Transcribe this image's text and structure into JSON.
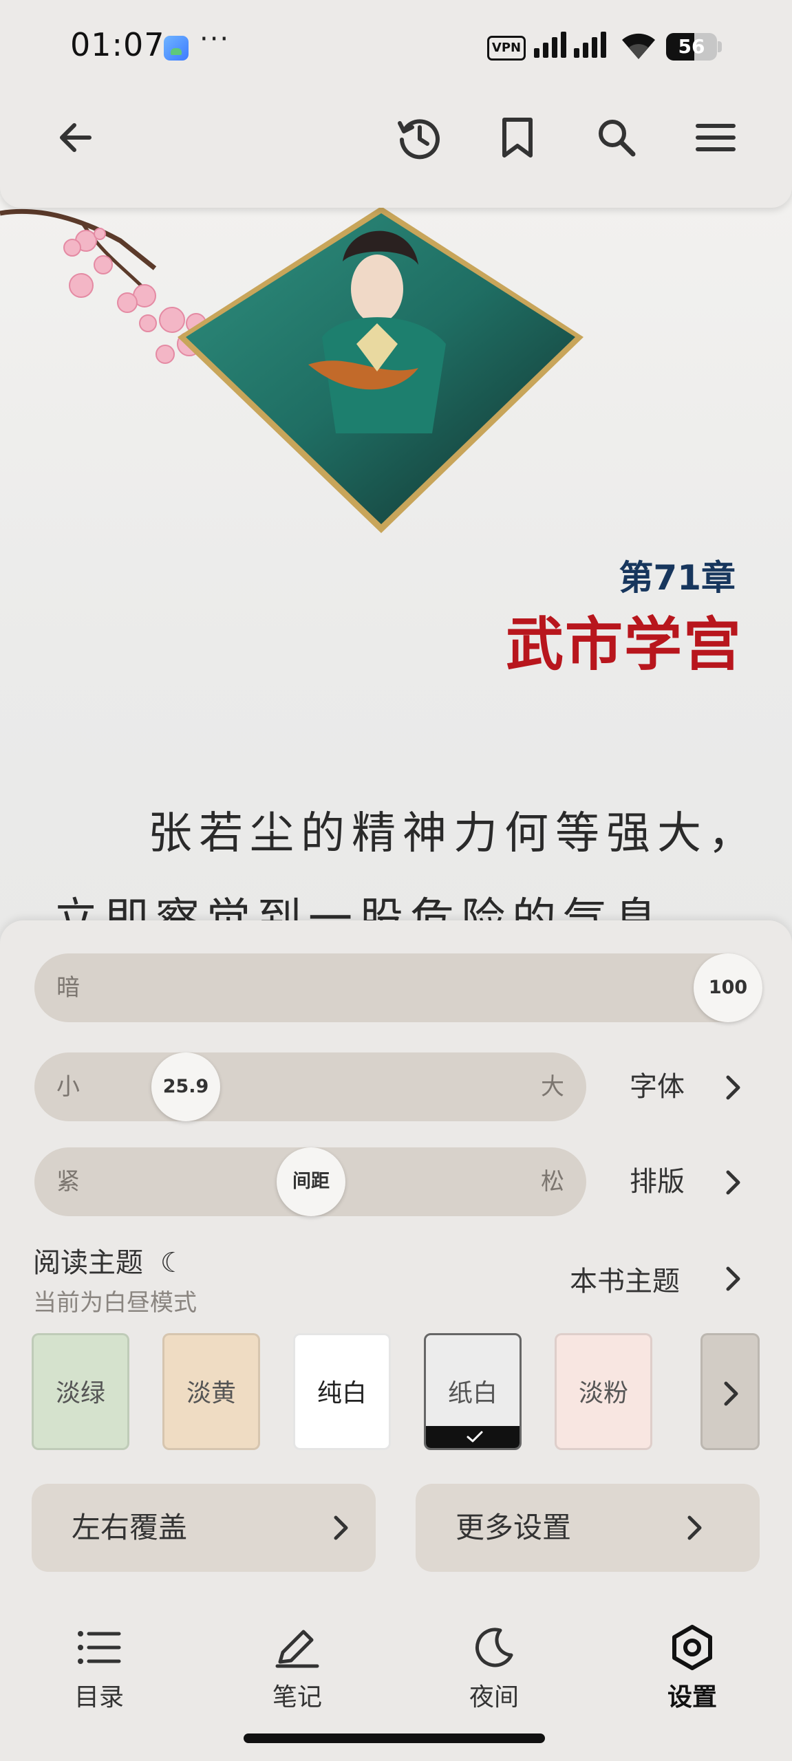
{
  "status_bar": {
    "time": "01:07",
    "more": "···",
    "vpn": "VPN",
    "battery": "56",
    "battery_level": 0.56
  },
  "toolbar": {
    "back_icon": "arrow-left-icon",
    "history_icon": "history-icon",
    "bookmark_icon": "bookmark-icon",
    "search_icon": "search-icon",
    "menu_icon": "menu-icon"
  },
  "content": {
    "chapter_number": "第71章",
    "chapter_title": "武市学宫",
    "line1": "张若尘的精神力何等强大，",
    "line2": "立即察觉到一股危险的气息"
  },
  "settings": {
    "brightness": {
      "label": "暗",
      "value": "100"
    },
    "font_size": {
      "min_label": "小",
      "max_label": "大",
      "value": "25.9",
      "link": "字体"
    },
    "spacing": {
      "min_label": "紧",
      "max_label": "松",
      "knob": "间距",
      "link": "排版"
    },
    "theme": {
      "title": "阅读主题",
      "moon": "☾",
      "subtitle": "当前为白昼模式",
      "book_theme": "本书主题",
      "swatches": [
        {
          "label": "淡绿",
          "color": "#d5e2cd"
        },
        {
          "label": "淡黄",
          "color": "#efdcc3"
        },
        {
          "label": "纯白",
          "color": "#ffffff"
        },
        {
          "label": "纸白",
          "color": "#ececec",
          "selected": true
        },
        {
          "label": "淡粉",
          "color": "#f8e6e1"
        }
      ]
    },
    "page_turn": "左右覆盖",
    "more_settings": "更多设置"
  },
  "bottom_nav": [
    {
      "label": "目录",
      "icon": "list-icon"
    },
    {
      "label": "笔记",
      "icon": "pen-icon"
    },
    {
      "label": "夜间",
      "icon": "moon-icon"
    },
    {
      "label": "设置",
      "icon": "settings-hexagon-icon",
      "active": true
    }
  ]
}
